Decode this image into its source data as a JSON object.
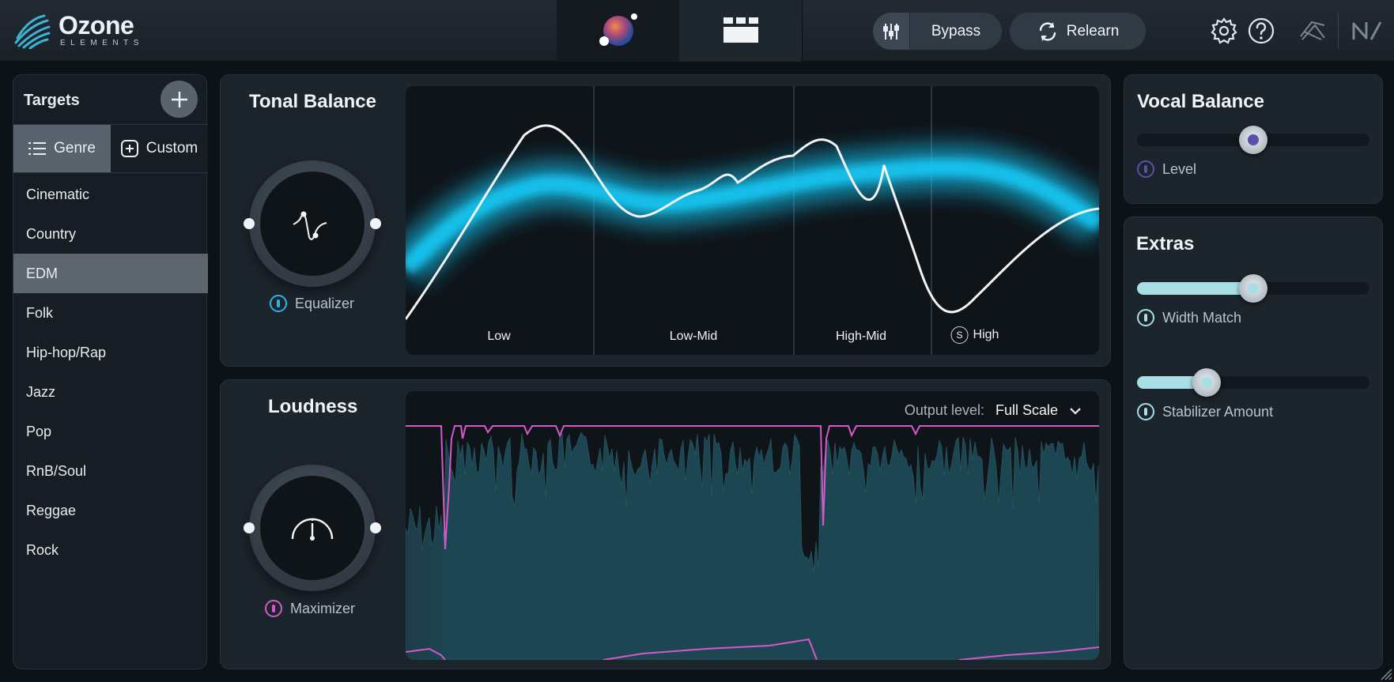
{
  "app": {
    "name": "Ozone",
    "edition": "ELEMENTS"
  },
  "header": {
    "bypass_label": "Bypass",
    "relearn_label": "Relearn"
  },
  "targets": {
    "title": "Targets",
    "tabs": [
      {
        "label": "Genre",
        "active": true
      },
      {
        "label": "Custom",
        "active": false
      }
    ],
    "genres": [
      "Cinematic",
      "Country",
      "EDM",
      "Folk",
      "Hip-hop/Rap",
      "Jazz",
      "Pop",
      "RnB/Soul",
      "Reggae",
      "Rock"
    ],
    "selected_genre": "EDM"
  },
  "tonal_balance": {
    "title": "Tonal Balance",
    "module_label": "Equalizer",
    "module_color": "#2bb3e8",
    "bands": [
      "Low",
      "Low-Mid",
      "High-Mid",
      "High"
    ],
    "solo_label": "S",
    "curve_color": "#f2f4f6",
    "target_color": "#18c6f2"
  },
  "loudness": {
    "title": "Loudness",
    "module_label": "Maximizer",
    "module_color": "#d658c8",
    "output_label": "Output level:",
    "output_value": "Full Scale"
  },
  "vocal_balance": {
    "title": "Vocal Balance",
    "level_label": "Level",
    "level_value": 0.5,
    "accent": "#5d4fa8"
  },
  "extras": {
    "title": "Extras",
    "controls": [
      {
        "label": "Width Match",
        "value": 0.5
      },
      {
        "label": "Stabilizer Amount",
        "value": 0.27
      }
    ],
    "accent": "#a8dfe6"
  },
  "icons": [
    "ozone-logo-icon",
    "assistant-orb-icon",
    "modules-grid-icon",
    "bypass-icon",
    "relearn-icon",
    "settings-gear-icon",
    "help-icon",
    "izotope-logo-icon",
    "ni-logo-icon",
    "add-icon",
    "list-icon",
    "custom-add-icon",
    "eq-curve-icon",
    "meter-gauge-icon",
    "resize-grip-icon"
  ]
}
